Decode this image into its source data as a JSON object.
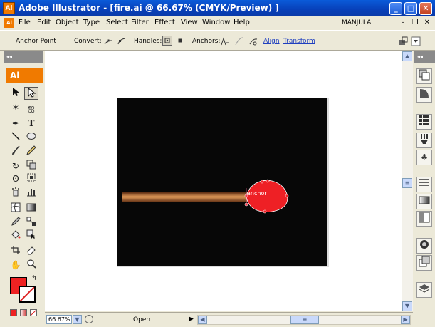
{
  "window": {
    "title": "Adobe Illustrator - [fire.ai @ 66.67% (CMYK/Preview) ]",
    "app_badge": "Ai",
    "minimize": "_",
    "maximize": "□",
    "close": "✕"
  },
  "menu": {
    "doc_badge": "Ai",
    "items": [
      "File",
      "Edit",
      "Object",
      "Type",
      "Select",
      "Filter",
      "Effect",
      "View",
      "Window",
      "Help"
    ],
    "user": "MANJULA",
    "mdi_min": "–",
    "mdi_restore": "❐",
    "mdi_close": "✕"
  },
  "control": {
    "tool_name": "Anchor Point",
    "convert_label": "Convert:",
    "handles_label": "Handles:",
    "anchors_label": "Anchors:",
    "align_link": "Align",
    "transform_link": "Transform"
  },
  "toolbox": {
    "collapse": "◂◂",
    "logo": "Ai",
    "type_tool": "T"
  },
  "canvas": {
    "anchor_label": "anchor",
    "colors": {
      "artboard": "#070707",
      "flame": "#ee2025",
      "stick": "#c8763a"
    }
  },
  "dock": {
    "collapse": "◂◂"
  },
  "status": {
    "zoom": "66.67%",
    "state": "Open"
  },
  "colors": {
    "fill": "#ee2222",
    "stroke": "#ffffff",
    "title_bar": "#0a4fc8",
    "app_orange": "#f07a00"
  }
}
